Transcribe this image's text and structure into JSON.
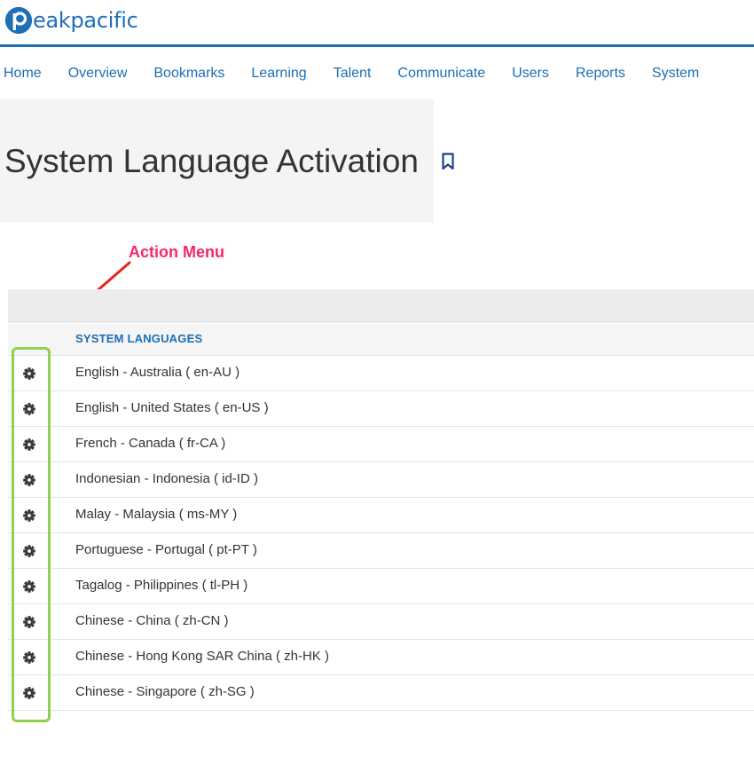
{
  "brand": {
    "logo_letter": "p",
    "logo_text": "eakpacific",
    "color": "#1f6fb6"
  },
  "nav": {
    "items": [
      {
        "label": "Home"
      },
      {
        "label": "Overview"
      },
      {
        "label": "Bookmarks"
      },
      {
        "label": "Learning"
      },
      {
        "label": "Talent"
      },
      {
        "label": "Communicate"
      },
      {
        "label": "Users"
      },
      {
        "label": "Reports"
      },
      {
        "label": "System"
      }
    ]
  },
  "page": {
    "title": "System Language Activation",
    "bookmark_icon": "bookmark-icon"
  },
  "annotation": {
    "label": "Action Menu",
    "color": "#ee2a6b",
    "highlight_color": "#8fd14f"
  },
  "table": {
    "column_header": "SYSTEM LANGUAGES",
    "row_icon": "gear-icon",
    "rows": [
      {
        "language": "English - Australia ( en-AU )"
      },
      {
        "language": "English - United States ( en-US )"
      },
      {
        "language": "French - Canada ( fr-CA )"
      },
      {
        "language": "Indonesian - Indonesia ( id-ID )"
      },
      {
        "language": "Malay - Malaysia ( ms-MY )"
      },
      {
        "language": "Portuguese - Portugal ( pt-PT )"
      },
      {
        "language": "Tagalog - Philippines ( tl-PH )"
      },
      {
        "language": "Chinese - China ( zh-CN )"
      },
      {
        "language": "Chinese - Hong Kong SAR China ( zh-HK )"
      },
      {
        "language": "Chinese - Singapore ( zh-SG )"
      }
    ]
  }
}
